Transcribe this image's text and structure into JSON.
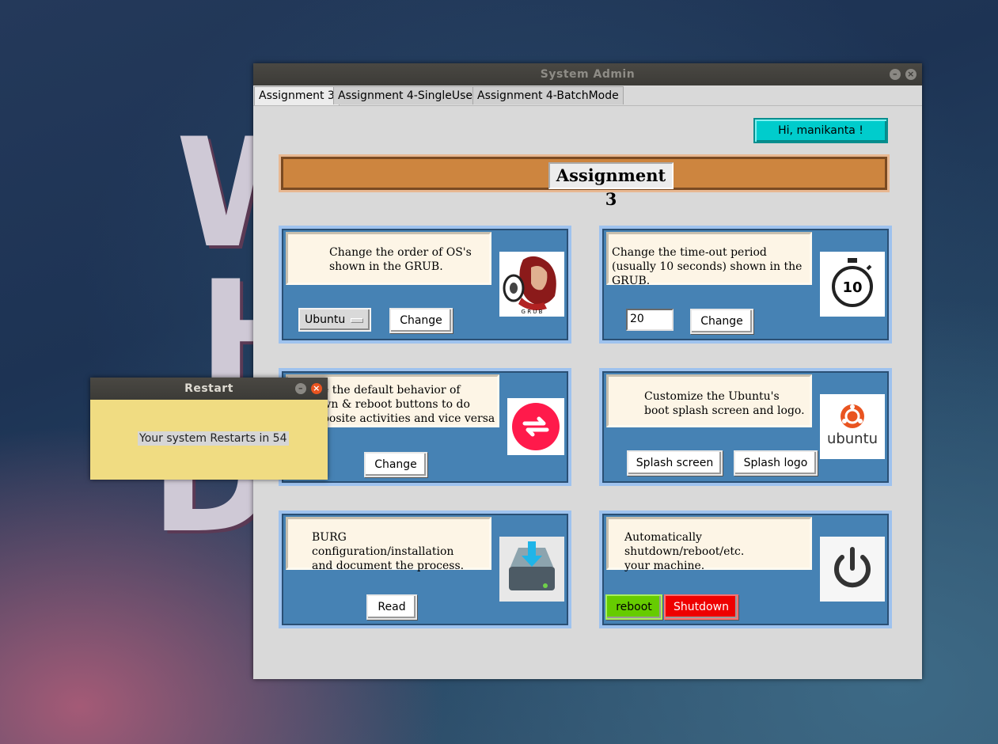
{
  "restart_dialog": {
    "title": "Restart",
    "message": "Your system Restarts in 54"
  },
  "window": {
    "title": "System Admin",
    "tabs": [
      {
        "label": "Assignment 3",
        "active": true
      },
      {
        "label": "Assignment 4-SingleUser",
        "active": false
      },
      {
        "label": "Assignment 4-BatchMode",
        "active": false
      }
    ],
    "greeting": "Hi, manikanta !",
    "banner_title": "Assignment 3"
  },
  "panels": {
    "grub_order": {
      "desc_line1": "Change the order of OS's",
      "desc_line2": "shown in the GRUB.",
      "os_select": "Ubuntu",
      "button": "Change",
      "icon": "grub-mascot-icon",
      "icon_caption": "G R U B"
    },
    "timeout": {
      "desc_line1": "Change the time-out period",
      "desc_line2": "(usually 10 seconds) shown in the GRUB.",
      "value": "20",
      "button": "Change",
      "icon": "stopwatch-icon",
      "icon_number": "10"
    },
    "power_swap": {
      "desc_line1": "ge the default behavior of",
      "desc_line2": "own & reboot buttons to do",
      "desc_line3": "pposite activities and vice versa",
      "button": "Change",
      "icon": "swap-arrows-icon"
    },
    "splash": {
      "desc_line1": "Customize the Ubuntu's",
      "desc_line2": "boot splash screen and logo.",
      "button1": "Splash screen",
      "button2": "Splash logo",
      "icon": "ubuntu-logo-icon",
      "logo_word": "ubuntu"
    },
    "burg": {
      "desc_line1": "BURG configuration/installation",
      "desc_line2": "and document the process.",
      "button": "Read",
      "icon": "drive-download-icon"
    },
    "auto_power": {
      "desc_line1": "Automatically shutdown/reboot/etc.",
      "desc_line2": "your machine.",
      "button_reboot": "reboot",
      "button_shutdown": "Shutdown",
      "icon": "power-icon",
      "colors": {
        "reboot": "#66cc00",
        "shutdown": "#ee0000"
      }
    }
  },
  "colors": {
    "panel": "#4682b4",
    "banner": "#cd853f",
    "greeting": "#00cccc",
    "dialog": "#f0dc82"
  }
}
